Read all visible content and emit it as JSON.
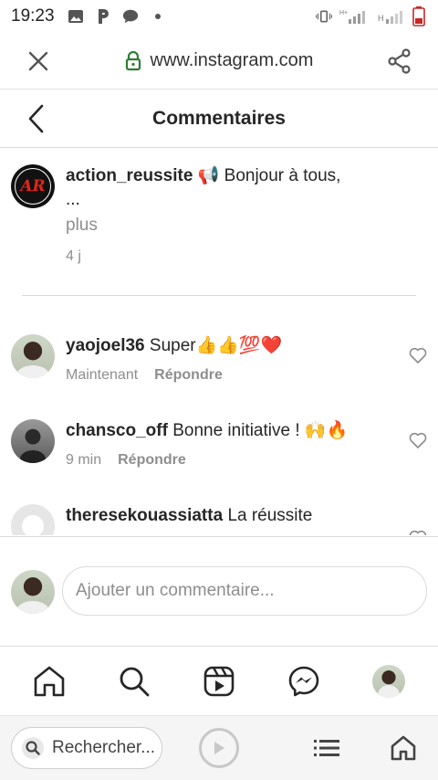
{
  "status_bar": {
    "time": "19:23",
    "network_label": "H+"
  },
  "browser": {
    "url": "www.instagram.com",
    "search_label": "Rechercher..."
  },
  "header": {
    "title": "Commentaires"
  },
  "caption": {
    "username": "action_reussite",
    "emoji": "📢",
    "text": "Bonjour à tous,",
    "ellipsis": "...",
    "more_label": "plus",
    "time": "4 j",
    "avatar_logo": "AR"
  },
  "comments": [
    {
      "username": "yaojoel36",
      "text": "Super👍👍💯❤️",
      "time": "Maintenant",
      "reply_label": "Répondre"
    },
    {
      "username": "chansco_off",
      "text": "Bonne initiative ! 🙌🔥",
      "time": "9 min",
      "reply_label": "Répondre"
    },
    {
      "username": "theresekouassiatta",
      "text": "La réussite",
      "time": "",
      "reply_label": ""
    }
  ],
  "add_comment": {
    "placeholder": "Ajouter un commentaire..."
  },
  "colors": {
    "secure_lock": "#2e7d32",
    "brand_red": "#e1251b",
    "muted_text": "#8e8e8e"
  }
}
